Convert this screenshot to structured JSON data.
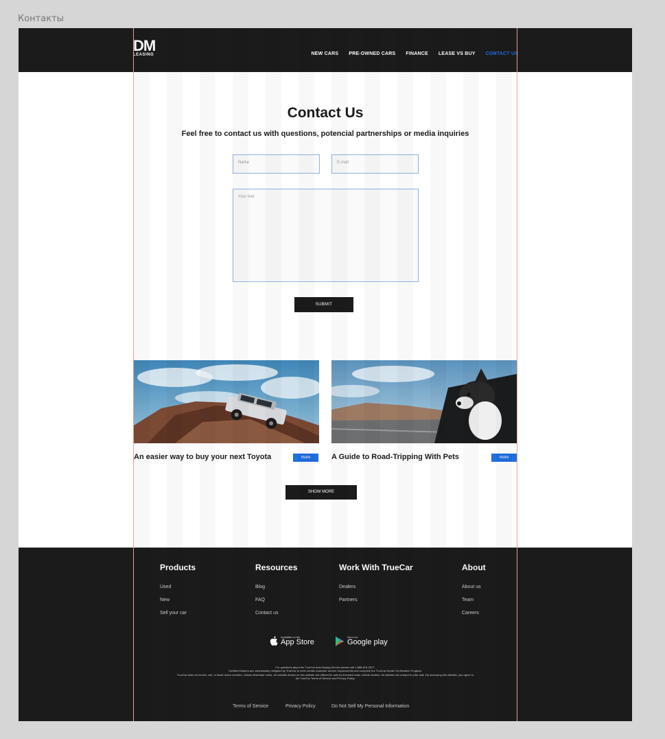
{
  "frame_label": "Контакты",
  "header": {
    "logo_main": "DM",
    "logo_sub": "LEASING",
    "nav": [
      "NEW CARS",
      "PRE-OWNED CARS",
      "FINANCE",
      "LEASE VS BUY",
      "CONTACT US"
    ],
    "active_nav": "CONTACT US"
  },
  "contact": {
    "title": "Contact Us",
    "subtitle": "Feel free to contact us with questions, potencial partnerships or media inquiries",
    "name_placeholder": "Name",
    "email_placeholder": "E-mail",
    "text_placeholder": "Your text",
    "submit_label": "SUBMIT"
  },
  "articles": [
    {
      "title": "An easier way to buy your next Toyota",
      "more_label": "more"
    },
    {
      "title": "A Guide to Road-Tripping With Pets",
      "more_label": "more"
    }
  ],
  "show_more_label": "SHOW MORE",
  "footer": {
    "columns": [
      {
        "heading": "Products",
        "links": [
          "Used",
          "New",
          "Sell your car"
        ]
      },
      {
        "heading": "Resources",
        "links": [
          "Blog",
          "FAQ",
          "Contact us"
        ]
      },
      {
        "heading": "Work With TrueCar",
        "links": [
          "Dealers",
          "Partners"
        ]
      },
      {
        "heading": "About",
        "links": [
          "About us",
          "Team",
          "Careers"
        ]
      }
    ],
    "app_store": {
      "small": "Available on the",
      "big": "App Store"
    },
    "google_play": {
      "small": "Get it on",
      "big": "Google play"
    },
    "legal": [
      "For questions about the TrueCar Auto Buying Service please call 1-888-878-3227.",
      "Certified Dealers are contractually obligated by TrueCar to meet certain customer service requirements and complete the TrueCar Dealer Certification Program.",
      "TrueCar does not broker, sell, or lease motor vehicles. Unless otherwise noted, all vehicles shown on this website are offered for sale by licensed motor vehicle dealers. All vehicles are subject to prior sale. By accessing this website, you agree to the TrueCar Terms of Service and Privacy Policy."
    ],
    "bottom_links": [
      "Terms of Service",
      "Privacy Policy",
      "Do Not Sell My Personal Information"
    ]
  },
  "colors": {
    "dark": "#1b1b1b",
    "accent": "#1e6fe0",
    "guide": "#e9a090"
  }
}
